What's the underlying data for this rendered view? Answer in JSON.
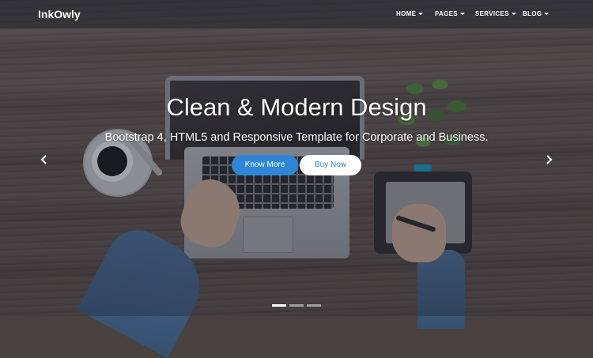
{
  "navbar": {
    "brand": "InkOwly",
    "items": [
      {
        "label": "HOME",
        "icon": "caret-down-icon"
      },
      {
        "label": "PAGES",
        "icon": "caret-down-icon"
      },
      {
        "label": "SERVICES",
        "icon": "caret-down-icon"
      },
      {
        "label": "BLOG",
        "icon": "caret-down-icon"
      }
    ]
  },
  "hero": {
    "title": "Clean & Modern Design",
    "subtitle": "Bootstrap 4, HTML5 and Responsive Template for Corporate and Business.",
    "primary_button": "Know More",
    "secondary_button": "Buy Now"
  },
  "carousel": {
    "prev_icon": "chevron-left-icon",
    "next_icon": "chevron-right-icon",
    "slide_count": 3,
    "active_slide": 1
  },
  "colors": {
    "accent": "#2f86d6",
    "text": "#ffffff"
  }
}
